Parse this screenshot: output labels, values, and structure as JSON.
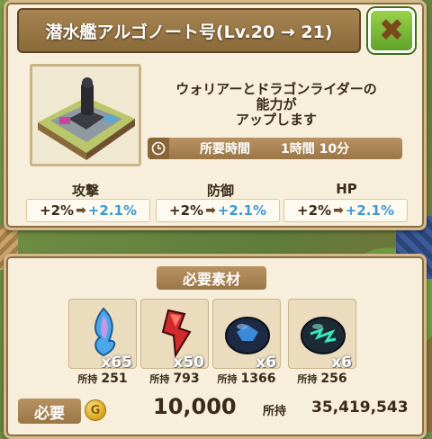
{
  "header": {
    "title": "潜水艦アルゴノート号(Lv.20 → 21)",
    "close_icon": "✖"
  },
  "description": {
    "lines": [
      "ウォリアーとドラゴンライダーの",
      "能力が",
      "アップします"
    ]
  },
  "time": {
    "label": "所要時間",
    "value": "1時間 10分"
  },
  "stats": [
    {
      "name": "攻撃",
      "old": "+2%",
      "new": "+2.1%"
    },
    {
      "name": "防御",
      "old": "+2%",
      "new": "+2.1%"
    },
    {
      "name": "HP",
      "old": "+2%",
      "new": "+2.1%"
    }
  ],
  "materials": {
    "title": "必要素材",
    "owned_label": "所持",
    "items": [
      {
        "icon": "blue-flame-icon",
        "qty": "x65",
        "owned": "251"
      },
      {
        "icon": "red-crystal-icon",
        "qty": "x50",
        "owned": "793"
      },
      {
        "icon": "dark-blue-slime-icon",
        "qty": "x6",
        "owned": "1366"
      },
      {
        "icon": "dark-green-slime-icon",
        "qty": "x6",
        "owned": "256"
      }
    ]
  },
  "cost": {
    "label": "必要",
    "coin_icon": "G",
    "value": "10,000",
    "owned_label": "所持",
    "owned_value": "35,419,543"
  },
  "colors": {
    "stat_new": "#3a9ad8",
    "panel_bg": "#f7efdc",
    "close_green": "#5fa32a"
  }
}
